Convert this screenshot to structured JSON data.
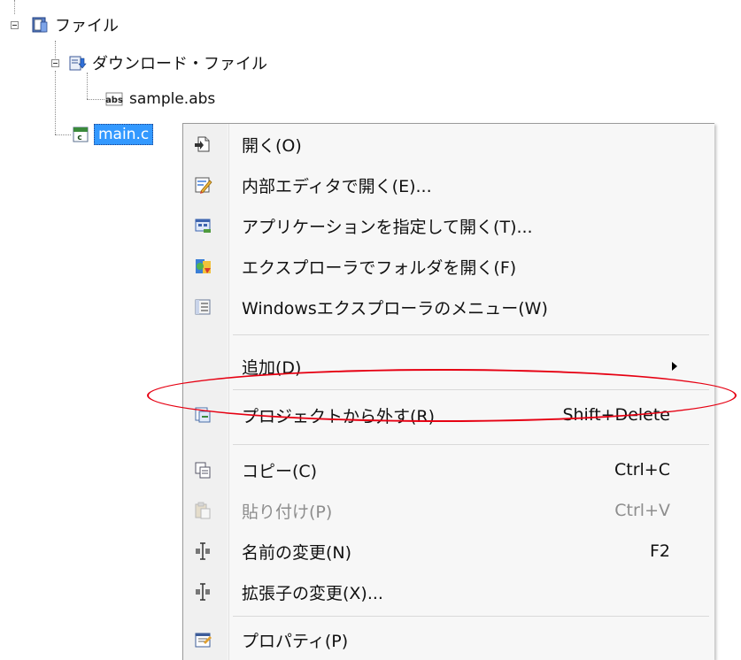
{
  "tree": {
    "root": {
      "label": "ファイル",
      "icon": "folder-file-icon"
    },
    "download_folder": {
      "label": "ダウンロード・ファイル",
      "icon": "download-folder-icon"
    },
    "abs_file": {
      "label": "sample.abs",
      "icon": "abs-file-icon",
      "icon_text": "abs"
    },
    "c_file": {
      "label": "main.c",
      "icon": "c-source-file-icon",
      "selected": true
    }
  },
  "menu": {
    "items": [
      {
        "label": "開く(O)",
        "icon": "open-icon"
      },
      {
        "label": "内部エディタで開く(E)...",
        "icon": "internal-editor-icon"
      },
      {
        "label": "アプリケーションを指定して開く(T)...",
        "icon": "open-with-application-icon"
      },
      {
        "label": "エクスプローラでフォルダを開く(F)",
        "icon": "explorer-folder-icon"
      },
      {
        "label": "Windowsエクスプローラのメニュー(W)",
        "icon": "windows-explorer-menu-icon"
      },
      {
        "label": "追加(D)",
        "submenu": true
      },
      {
        "label": "プロジェクトから外す(R)",
        "shortcut": "Shift+Delete",
        "icon": "remove-from-project-icon",
        "highlighted": true
      },
      {
        "label": "コピー(C)",
        "shortcut": "Ctrl+C",
        "icon": "copy-icon"
      },
      {
        "label": "貼り付け(P)",
        "shortcut": "Ctrl+V",
        "icon": "paste-icon",
        "disabled": true
      },
      {
        "label": "名前の変更(N)",
        "shortcut": "F2",
        "icon": "rename-icon"
      },
      {
        "label": "拡張子の変更(X)...",
        "icon": "change-extension-icon"
      },
      {
        "label": "プロパティ(P)",
        "icon": "properties-icon"
      }
    ]
  },
  "colors": {
    "selection": "#3399ff",
    "annotation": "#e60012",
    "menu_background": "#f7f7f7",
    "disabled_text": "#8d8d8d"
  }
}
